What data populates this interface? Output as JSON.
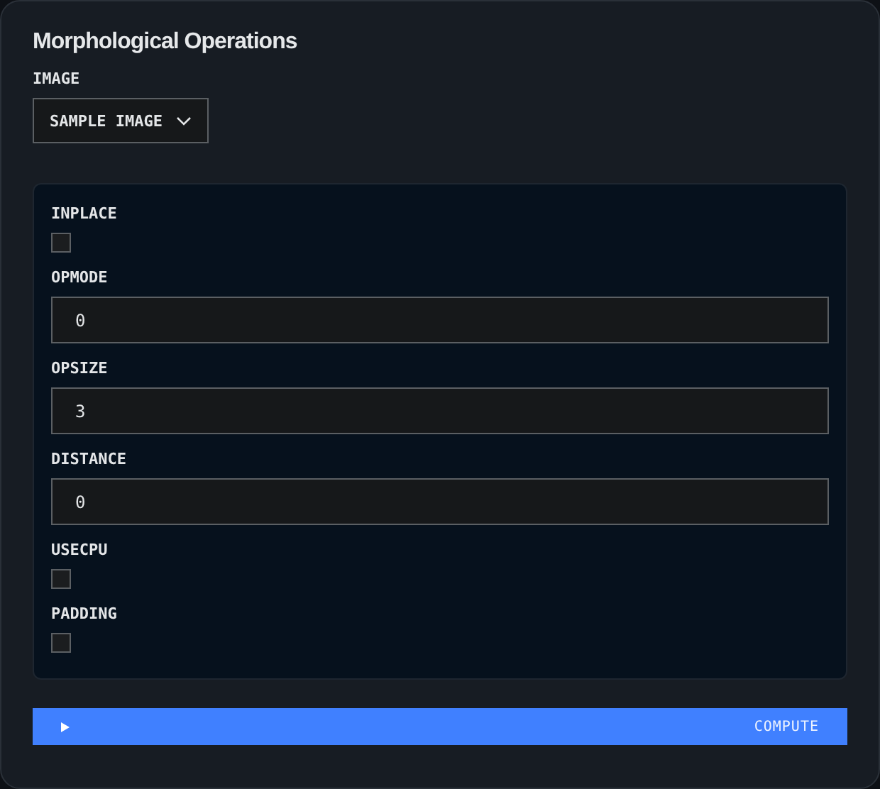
{
  "title": "Morphological Operations",
  "image": {
    "label": "IMAGE",
    "value": "SAMPLE IMAGE"
  },
  "params": [
    {
      "kind": "checkbox",
      "label": "INPLACE",
      "checked": false
    },
    {
      "kind": "number",
      "label": "OPMODE",
      "value": "0"
    },
    {
      "kind": "number",
      "label": "OPSIZE",
      "value": "3"
    },
    {
      "kind": "number",
      "label": "DISTANCE",
      "value": "0"
    },
    {
      "kind": "checkbox",
      "label": "USECPU",
      "checked": false
    },
    {
      "kind": "checkbox",
      "label": "PADDING",
      "checked": false
    }
  ],
  "compute_button": {
    "label": "COMPUTE"
  }
}
